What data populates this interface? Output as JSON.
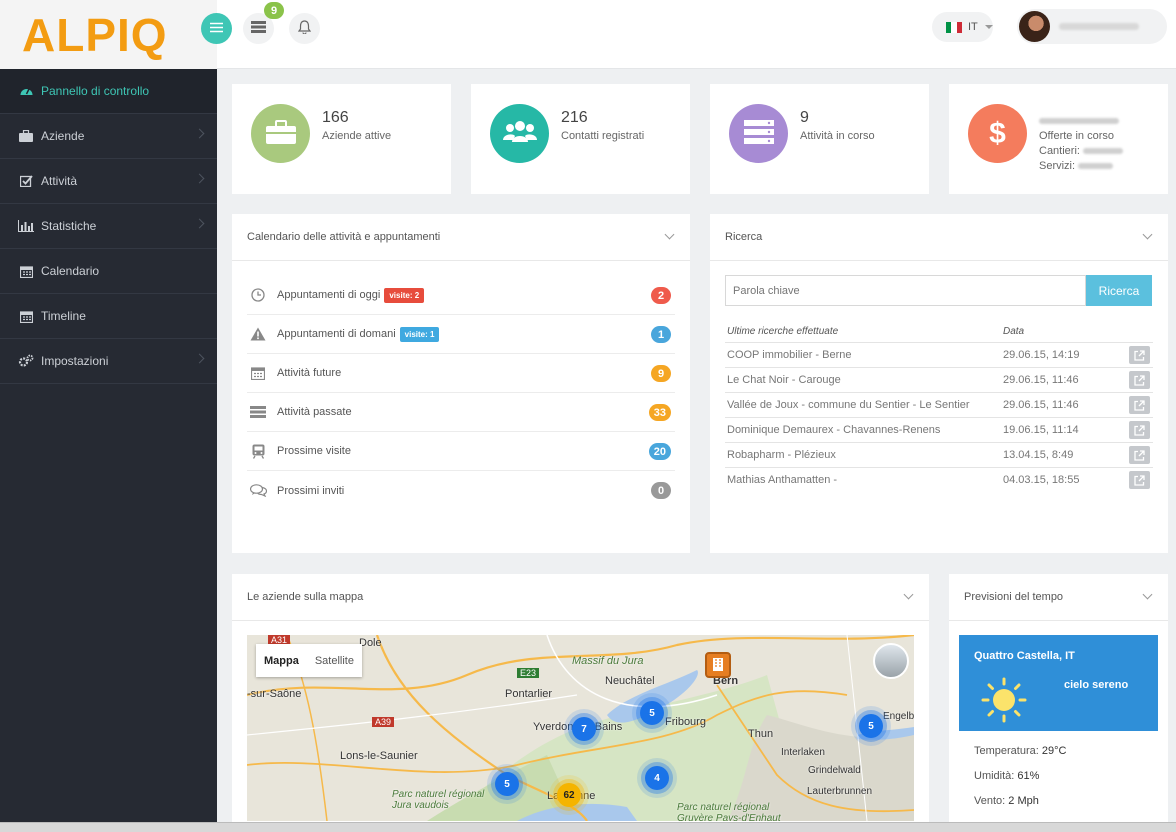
{
  "brand": {
    "logo_text": "ALPIQ",
    "accent": "#3ec6b5"
  },
  "header": {
    "notifications_count": "9",
    "language": "IT"
  },
  "sidebar": {
    "items": [
      {
        "label": "Pannello di controllo",
        "icon": "dashboard-icon"
      },
      {
        "label": "Aziende",
        "icon": "briefcase-icon"
      },
      {
        "label": "Attività",
        "icon": "checkbox-icon"
      },
      {
        "label": "Statistiche",
        "icon": "bar-chart-icon"
      },
      {
        "label": "Calendario",
        "icon": "calendar-icon"
      },
      {
        "label": "Timeline",
        "icon": "calendar-icon"
      },
      {
        "label": "Impostazioni",
        "icon": "cogs-icon"
      }
    ]
  },
  "stats": [
    {
      "number": "166",
      "label": "Aziende attive",
      "color": "#a9c97e"
    },
    {
      "number": "216",
      "label": "Contatti registrati",
      "color": "#26b8a6"
    },
    {
      "number": "9",
      "label": "Attività in corso",
      "color": "#a78bd4"
    },
    {
      "label": "Offerte in corso",
      "line2": "Cantieri:",
      "line3": "Servizi:",
      "color": "#f47c5d"
    }
  ],
  "calendar": {
    "title": "Calendario delle attività e appuntamenti",
    "rows": [
      {
        "label": "Appuntamenti di oggi",
        "tag": "visite: 2",
        "count": "2"
      },
      {
        "label": "Appuntamenti di domani",
        "tag": "visite: 1",
        "count": "1"
      },
      {
        "label": "Attività future",
        "count": "9"
      },
      {
        "label": "Attività passate",
        "count": "33"
      },
      {
        "label": "Prossime visite",
        "count": "20"
      },
      {
        "label": "Prossimi inviti",
        "count": "0"
      }
    ]
  },
  "search": {
    "title": "Ricerca",
    "placeholder": "Parola chiave",
    "button": "Ricerca",
    "col_query": "Ultime ricerche effettuate",
    "col_date": "Data",
    "rows": [
      {
        "query": "COOP immobilier - Berne",
        "date": "29.06.15, 14:19"
      },
      {
        "query": "Le Chat Noir - Carouge",
        "date": "29.06.15, 11:46"
      },
      {
        "query": "Vallée de Joux - commune du Sentier - Le Sentier",
        "date": "29.06.15, 11:46"
      },
      {
        "query": "Dominique Demaurex - Chavannes-Renens",
        "date": "19.06.15, 11:14"
      },
      {
        "query": "Robapharm - Plézieux",
        "date": "13.04.15, 8:49"
      },
      {
        "query": "Mathias Anthamatten -",
        "date": "04.03.15, 18:55"
      }
    ]
  },
  "map": {
    "title": "Le aziende sulla mappa",
    "mode_map": "Mappa",
    "mode_satellite": "Satellite",
    "places": [
      "Dole",
      "Pontarlier",
      "Neuchâtel",
      "Bern",
      "Yverdon-les-Bains",
      "Fribourg",
      "Thun",
      "Interlaken",
      "Lons-le-Saunier",
      "Lausanne",
      "Grindelwald",
      "Lauterbrunnen",
      "Engelb",
      "Massif du Jura",
      "Parc naturel régional Jura vaudois",
      "Parc naturel régional Gruyère Pays-d'Enhaut",
      "-sur-Saône",
      "A31",
      "A39",
      "E23"
    ],
    "clusters": [
      "7",
      "5",
      "5",
      "5",
      "4",
      "62"
    ]
  },
  "weather": {
    "title": "Previsioni del tempo",
    "location": "Quattro Castella, IT",
    "condition": "cielo sereno",
    "temp_label": "Temperatura:",
    "temp": "29°C",
    "humidity_label": "Umidità:",
    "humidity": "61%",
    "wind_label": "Vento:",
    "wind": "2 Mph"
  }
}
